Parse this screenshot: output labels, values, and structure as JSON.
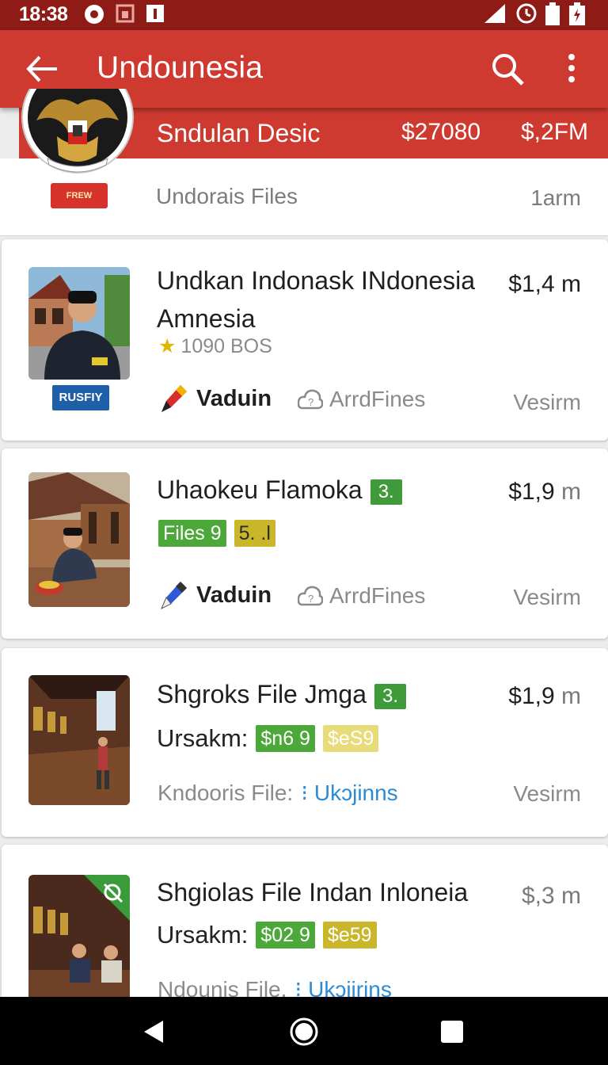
{
  "status_bar": {
    "time": "18:38",
    "icons": [
      "record-icon",
      "gallery-icon",
      "notification-icon",
      "signal-icon",
      "clock-icon",
      "battery-icon",
      "battery-charging-icon"
    ]
  },
  "app_bar": {
    "title": "Undounesia",
    "back_icon": "arrow-left-icon",
    "search_icon": "search-icon",
    "menu_icon": "more-vert-icon"
  },
  "header": {
    "title": "Sndulan Desic",
    "price1": "$27080",
    "price2": "$,2FM",
    "badge": "FREW",
    "files_label": "Undorais Files",
    "files_count": "1arm"
  },
  "listings": [
    {
      "title_line1": "Undkan Indonask INdonesia",
      "title_line2": "Amnesia",
      "price": "$1,4",
      "price_unit": "m",
      "rating": "1090 BOS",
      "badge": "RUSFIY",
      "action_label": "Vaduin",
      "cloud_label": "ArrdFines",
      "right_label": "Vesirm"
    },
    {
      "title": "Uhaokeu Flamoka",
      "tag": "3.",
      "price": "$1,9",
      "price_unit": "m",
      "chips": [
        "Files 9",
        "5. .l"
      ],
      "action_label": "Vaduin",
      "cloud_label": "ArrdFines",
      "right_label": "Vesirm"
    },
    {
      "title": "Shgroks File Jmga",
      "tag": "3.",
      "price": "$1,9",
      "price_unit": "m",
      "ursak_label": "Ursakm:",
      "chips": [
        "$n6 9",
        "$eS9"
      ],
      "source_label": "Kndooris File:",
      "source_link": "Ukɔjinns",
      "right_label": "Vesirm"
    },
    {
      "title": "Shgiolas File Indan Inloneia",
      "price": "$,3",
      "price_unit": "m",
      "ursak_label": "Ursakm:",
      "chips": [
        "$02 9",
        "$e59"
      ],
      "source_label": "Ndounis File.",
      "source_link": "Ukɔjirins"
    }
  ],
  "nav_bar": {
    "back": "nav-back-icon",
    "home": "nav-home-icon",
    "recents": "nav-recents-icon"
  }
}
